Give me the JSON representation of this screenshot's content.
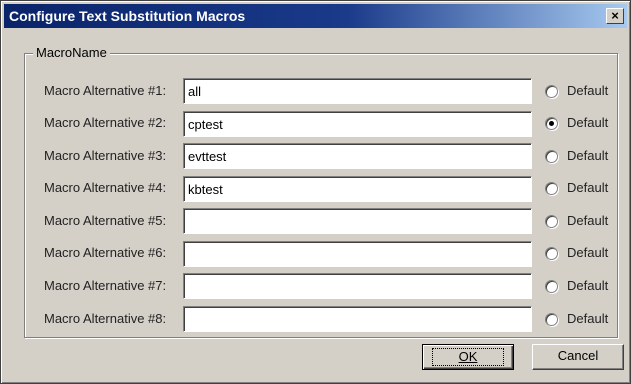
{
  "window": {
    "title": "Configure Text Substitution Macros",
    "close_glyph": "×"
  },
  "group": {
    "legend": "MacroName"
  },
  "rows": [
    {
      "label": "Macro Alternative #1:",
      "value": "all",
      "default_label": "Default",
      "default_selected": false
    },
    {
      "label": "Macro Alternative #2:",
      "value": "cptest",
      "default_label": "Default",
      "default_selected": true
    },
    {
      "label": "Macro Alternative #3:",
      "value": "evttest",
      "default_label": "Default",
      "default_selected": false
    },
    {
      "label": "Macro Alternative #4:",
      "value": "kbtest",
      "default_label": "Default",
      "default_selected": false
    },
    {
      "label": "Macro Alternative #5:",
      "value": "",
      "default_label": "Default",
      "default_selected": false
    },
    {
      "label": "Macro Alternative #6:",
      "value": "",
      "default_label": "Default",
      "default_selected": false
    },
    {
      "label": "Macro Alternative #7:",
      "value": "",
      "default_label": "Default",
      "default_selected": false
    },
    {
      "label": "Macro Alternative #8:",
      "value": "",
      "default_label": "Default",
      "default_selected": false
    }
  ],
  "buttons": {
    "ok_label": "OK",
    "cancel_label": "Cancel"
  },
  "colors": {
    "title_bar_start": "#0a246a",
    "title_bar_end": "#a6caf0",
    "face": "#d4d0c8"
  }
}
